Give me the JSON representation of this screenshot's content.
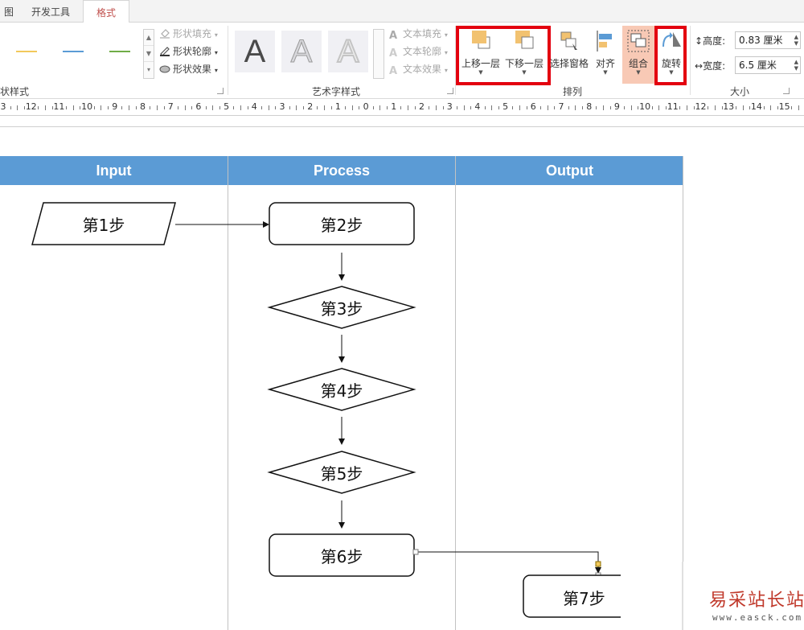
{
  "tabs": [
    {
      "label": "图"
    },
    {
      "label": "开发工具"
    },
    {
      "label": "格式"
    }
  ],
  "ribbon": {
    "shape_styles": {
      "group_label": "状样式",
      "line_colors": [
        "#f2c95c",
        "#5b9bd5",
        "#70ad47"
      ],
      "fill": "形状填充",
      "outline": "形状轮廓",
      "effects": "形状效果"
    },
    "wordart": {
      "group_label": "艺术字样式",
      "text_fill": "文本填充",
      "text_outline": "文本轮廓",
      "text_effects": "文本效果",
      "sample_glyph": "A"
    },
    "arrange": {
      "group_label": "排列",
      "bring_forward": "上移一层",
      "send_backward": "下移一层",
      "selection_pane": "选择窗格",
      "align": "对齐",
      "group": "组合",
      "rotate": "旋转"
    },
    "size": {
      "group_label": "大小",
      "height_label": "高度:",
      "height_value": "0.83 厘米",
      "width_label": "宽度:",
      "width_value": "6.5 厘米"
    }
  },
  "ruler": {
    "labels": [
      "3",
      "12",
      "11",
      "10",
      "9",
      "8",
      "7",
      "6",
      "5",
      "4",
      "3",
      "2",
      "1",
      "0",
      "1",
      "2",
      "3",
      "4",
      "5",
      "6",
      "7",
      "8",
      "9",
      "10",
      "11",
      "12",
      "13",
      "14",
      "15"
    ]
  },
  "flowchart": {
    "lanes": [
      {
        "header": "Input"
      },
      {
        "header": "Process"
      },
      {
        "header": "Output"
      }
    ],
    "header_color": "#5b9bd5",
    "nodes": {
      "step1": "第1步",
      "step2": "第2步",
      "step3": "第3步",
      "step4": "第4步",
      "step5": "第5步",
      "step6": "第6步",
      "step7": "第7步"
    }
  },
  "watermark": {
    "brand": "易采站长站",
    "url": "www.easck.com"
  },
  "colors": {
    "active_tab_text": "#c0504d",
    "highlight_box": "#e3000f",
    "group_button_bg": "#f8c9b5"
  }
}
